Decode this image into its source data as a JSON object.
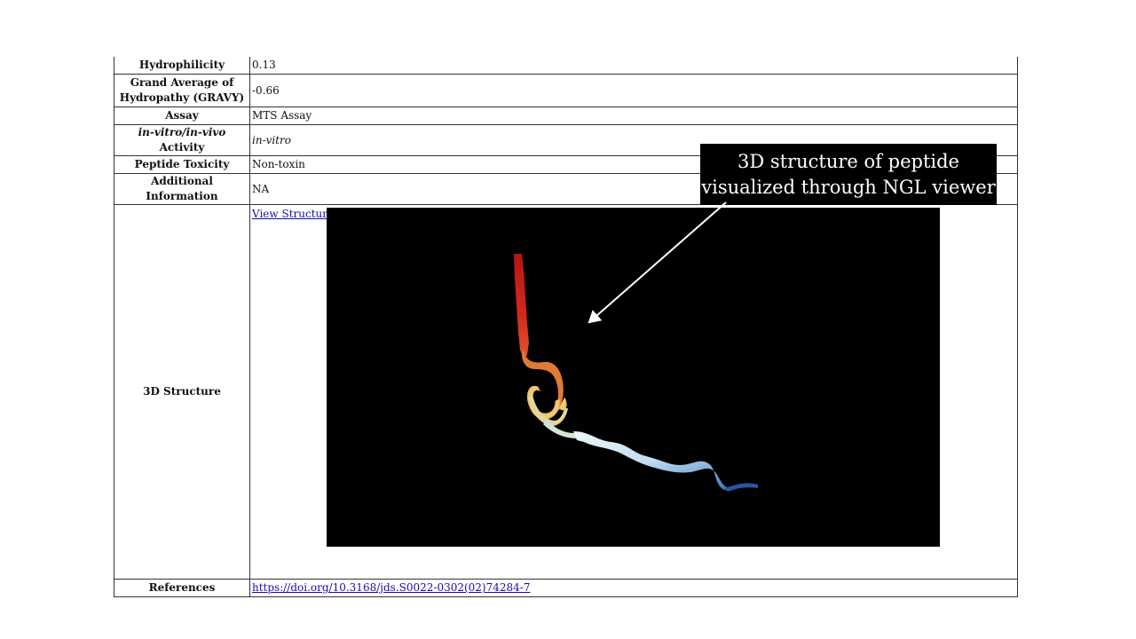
{
  "table": {
    "rows": [
      {
        "label": "Hydrophilicity",
        "value": "0.13"
      },
      {
        "label": "Grand Average of Hydropathy (GRAVY)",
        "value": "-0.66"
      },
      {
        "label": "Assay",
        "value": "MTS Assay"
      },
      {
        "label_italic": "in-vitro/in-vivo",
        "label_rest": " Activity",
        "value": "in-vitro"
      },
      {
        "label": "Peptide Toxicity",
        "value": "Non-toxin"
      },
      {
        "label": "Additional Information",
        "value": "NA"
      }
    ],
    "structure": {
      "label": "3D Structure",
      "link_text": "View Structure"
    },
    "references": {
      "label": "References",
      "link_text": "https://doi.org/10.3168/jds.S0022-0302(02)74284-7"
    }
  },
  "viewer": {
    "background": "#000000",
    "ribbon_colors": [
      "#c81c1c",
      "#e0542a",
      "#e8a24e",
      "#f0d890",
      "#d8ecf4",
      "#a8cce4",
      "#5a8ec8",
      "#2e5ea8"
    ]
  },
  "callout": {
    "line1": "3D structure of peptide",
    "line2": "visualized through NGL viewer"
  }
}
